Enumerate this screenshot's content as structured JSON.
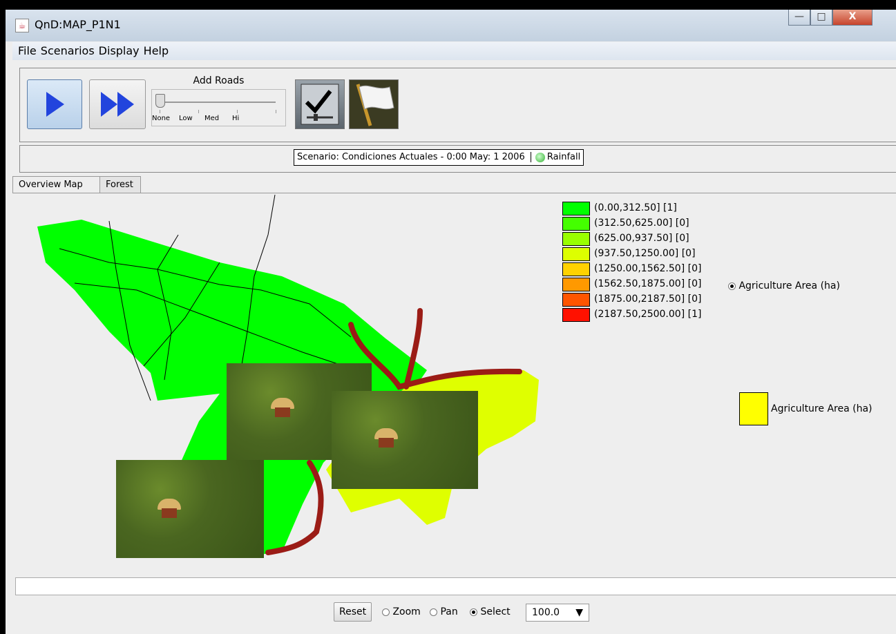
{
  "window": {
    "title": "QnD:MAP_P1N1",
    "min_label": "—",
    "max_label": "□",
    "close_label": "X"
  },
  "menu": [
    "File",
    "Scenarios",
    "Display",
    "Help"
  ],
  "toolbar": {
    "slider_title": "Add Roads",
    "slider_ticks": [
      "None",
      "Low",
      "Med",
      "Hi"
    ],
    "slider_value": "None"
  },
  "scenario": {
    "text": "Scenario: Condiciones Actuales - 0:00 May:  1 2006",
    "rainfall_label": "Rainfall"
  },
  "tabs": [
    "Overview Map",
    "Forest"
  ],
  "legend": {
    "items": [
      {
        "label": "(0.00,312.50] [1]",
        "color": "#00ff00"
      },
      {
        "label": "(312.50,625.00] [0]",
        "color": "#44ff00"
      },
      {
        "label": "(625.00,937.50] [0]",
        "color": "#99ff00"
      },
      {
        "label": "(937.50,1250.00] [0]",
        "color": "#ddff00"
      },
      {
        "label": "(1250.00,1562.50] [0]",
        "color": "#ffd200"
      },
      {
        "label": "(1562.50,1875.00] [0]",
        "color": "#ff9900"
      },
      {
        "label": "(1875.00,2187.50] [0]",
        "color": "#ff5500"
      },
      {
        "label": "(2187.50,2500.00] [1]",
        "color": "#ff1100"
      }
    ],
    "radio_label": "Agriculture Area (ha)",
    "swatch_label": "Agriculture Area (ha)",
    "swatch_color": "#ffff00"
  },
  "map": {
    "region_green": "#00ff00",
    "region_yellow": "#dfff00",
    "road_color": "#9b1c16"
  },
  "status_text": "",
  "controls": {
    "reset_label": "Reset",
    "modes": [
      "Zoom",
      "Pan",
      "Select"
    ],
    "selected_mode": "Select",
    "zoom_value": "100.0"
  }
}
